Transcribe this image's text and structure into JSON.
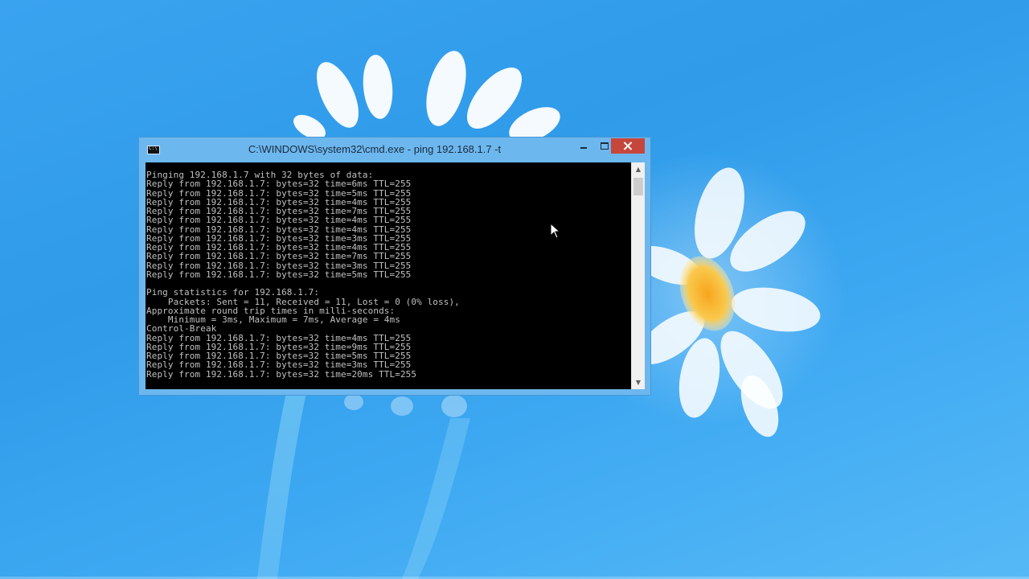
{
  "window": {
    "title": "C:\\WINDOWS\\system32\\cmd.exe - ping  192.168.1.7 -t"
  },
  "console": {
    "lines": [
      "Pinging 192.168.1.7 with 32 bytes of data:",
      "Reply from 192.168.1.7: bytes=32 time=6ms TTL=255",
      "Reply from 192.168.1.7: bytes=32 time=5ms TTL=255",
      "Reply from 192.168.1.7: bytes=32 time=4ms TTL=255",
      "Reply from 192.168.1.7: bytes=32 time=7ms TTL=255",
      "Reply from 192.168.1.7: bytes=32 time=4ms TTL=255",
      "Reply from 192.168.1.7: bytes=32 time=4ms TTL=255",
      "Reply from 192.168.1.7: bytes=32 time=3ms TTL=255",
      "Reply from 192.168.1.7: bytes=32 time=4ms TTL=255",
      "Reply from 192.168.1.7: bytes=32 time=7ms TTL=255",
      "Reply from 192.168.1.7: bytes=32 time=3ms TTL=255",
      "Reply from 192.168.1.7: bytes=32 time=5ms TTL=255",
      "",
      "Ping statistics for 192.168.1.7:",
      "    Packets: Sent = 11, Received = 11, Lost = 0 (0% loss),",
      "Approximate round trip times in milli-seconds:",
      "    Minimum = 3ms, Maximum = 7ms, Average = 4ms",
      "Control-Break",
      "Reply from 192.168.1.7: bytes=32 time=4ms TTL=255",
      "Reply from 192.168.1.7: bytes=32 time=9ms TTL=255",
      "Reply from 192.168.1.7: bytes=32 time=5ms TTL=255",
      "Reply from 192.168.1.7: bytes=32 time=3ms TTL=255",
      "Reply from 192.168.1.7: bytes=32 time=20ms TTL=255"
    ]
  },
  "icons": {
    "app": "cmd-icon",
    "minimize": "minimize-icon",
    "maximize": "maximize-icon",
    "close": "close-icon",
    "scroll_up": "scroll-up-arrow-icon",
    "scroll_down": "scroll-down-arrow-icon",
    "cursor": "mouse-pointer-icon"
  },
  "colors": {
    "desktop_background": "#3aa3f0",
    "window_frame": "#6db7ef",
    "close_button": "#c7463b",
    "console_background": "#000000",
    "console_text": "#c0c0c0"
  }
}
